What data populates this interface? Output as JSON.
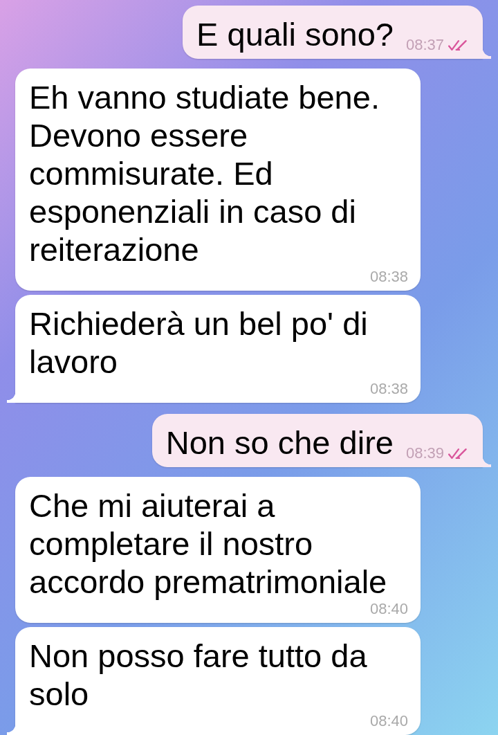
{
  "messages": [
    {
      "kind": "outgoing",
      "text": "E quali sono?",
      "time": "08:37",
      "read": true,
      "tail": true
    },
    {
      "kind": "incoming",
      "text": "Eh vanno studiate bene. Devono essere commisurate. Ed esponenziali in caso di reiterazione",
      "time": "08:38",
      "tail": false
    },
    {
      "kind": "incoming",
      "text": "Richiederà un bel po' di lavoro",
      "time": "08:38",
      "tail": true
    },
    {
      "kind": "outgoing",
      "text": "Non so che dire",
      "time": "08:39",
      "read": true,
      "tail": true
    },
    {
      "kind": "incoming",
      "text": "Che mi aiuterai a completare il nostro accordo prematrimoniale",
      "time": "08:40",
      "tail": false
    },
    {
      "kind": "incoming",
      "text": "Non posso fare tutto da solo",
      "time": "08:40",
      "tail": true
    }
  ]
}
